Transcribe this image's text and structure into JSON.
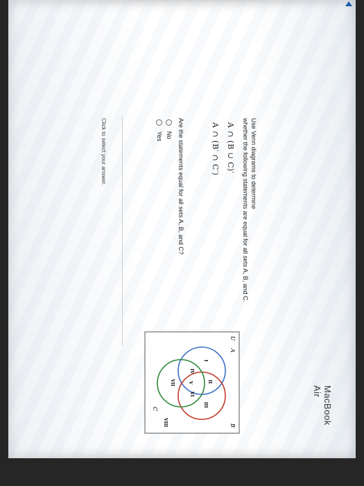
{
  "problem": {
    "instruction_line1": "Use Venn diagrams to determine",
    "instruction_line2": "whether the following statements are equal for all sets A, B, and C.",
    "statement1": "A ∩ (B ∪ C)′",
    "statement2": "A ∩ (B′ ∩ C′)"
  },
  "venn": {
    "universe_label": "U",
    "set_a_label": "A",
    "set_b_label": "B",
    "set_c_label": "C",
    "regions": [
      "I",
      "II",
      "III",
      "IV",
      "V",
      "VI",
      "VII",
      "VIII"
    ],
    "colors": {
      "a": "#3a6fc4",
      "b": "#c0392b",
      "c": "#2e8b3a"
    }
  },
  "question": {
    "text": "Are the statements equal for all sets A, B, and C?",
    "options": [
      "No",
      "Yes"
    ]
  },
  "footer_hint": "Click to select your answer.",
  "device_label": "MacBook Air"
}
